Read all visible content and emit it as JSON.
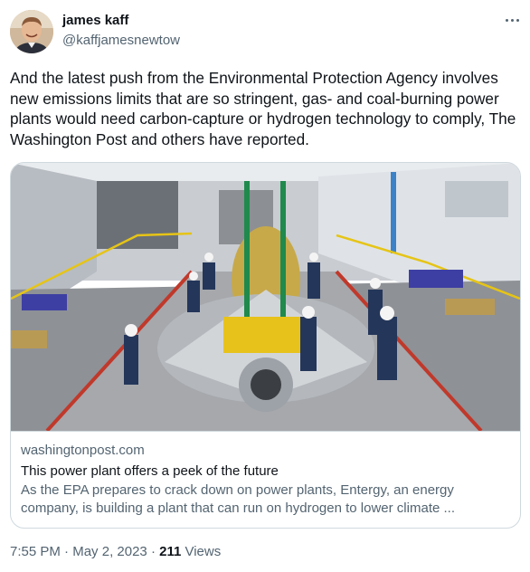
{
  "author": {
    "display_name": "james kaff",
    "handle": "@kaffjamesnewtow",
    "avatar_icon": "user-avatar"
  },
  "tweet": {
    "text": "And the latest push from the Environmental Protection Agency involves new emissions limits that are so stringent, gas- and coal-burning power plants would need carbon-capture or hydrogen technology to comply, The Washington Post and others have reported."
  },
  "link_card": {
    "domain": "washingtonpost.com",
    "title": "This power plant offers a peek of the future",
    "description": "As the EPA prepares to crack down on power plants, Entergy, an energy company, is building a plant that can run on hydrogen to lower climate ..."
  },
  "meta": {
    "time": "7:55 PM",
    "separator1": " · ",
    "date": "May 2, 2023",
    "separator2": " · ",
    "views_count": "211",
    "views_label": " Views"
  },
  "colors": {
    "text_primary": "#0f1419",
    "text_secondary": "#536471",
    "border": "#cfd9de"
  },
  "icons": {
    "more": "more-horizontal-icon"
  }
}
